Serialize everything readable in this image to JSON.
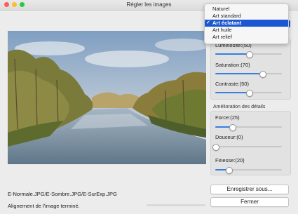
{
  "window": {
    "title": "Régler les images"
  },
  "preview": {
    "image_alt": "Rivière bordée d'arbres"
  },
  "menu": {
    "items": [
      {
        "label": "Naturel",
        "selected": false
      },
      {
        "label": "Art standard",
        "selected": false
      },
      {
        "label": "Art éclatant",
        "selected": true,
        "check": "✓"
      },
      {
        "label": "Art huile",
        "selected": false
      },
      {
        "label": "Art relief",
        "selected": false
      }
    ]
  },
  "controls": {
    "luminosite": {
      "label": "Luminosité:(50)",
      "value": 50
    },
    "saturation": {
      "label": "Saturation:(70)",
      "value": 70
    },
    "contraste": {
      "label": "Contraste:(50)",
      "value": 50
    }
  },
  "details": {
    "section_title": "Amélioration des détails",
    "force": {
      "label": "Force:(25)",
      "value": 25
    },
    "douceur": {
      "label": "Douceur:(0)",
      "value": 0
    },
    "finesse": {
      "label": "Finesse:(20)",
      "value": 20
    }
  },
  "buttons": {
    "save": "Enregistrer sous...",
    "close": "Fermer"
  },
  "footer": {
    "files": "E-Normale.JPG/E-Sombre.JPG/E-SurExp.JPG",
    "status": "Alignement de l'image terminé.",
    "progress": 0
  },
  "colors": {
    "accent": "#3a7fe0",
    "menu_highlight": "#1a57d1"
  }
}
